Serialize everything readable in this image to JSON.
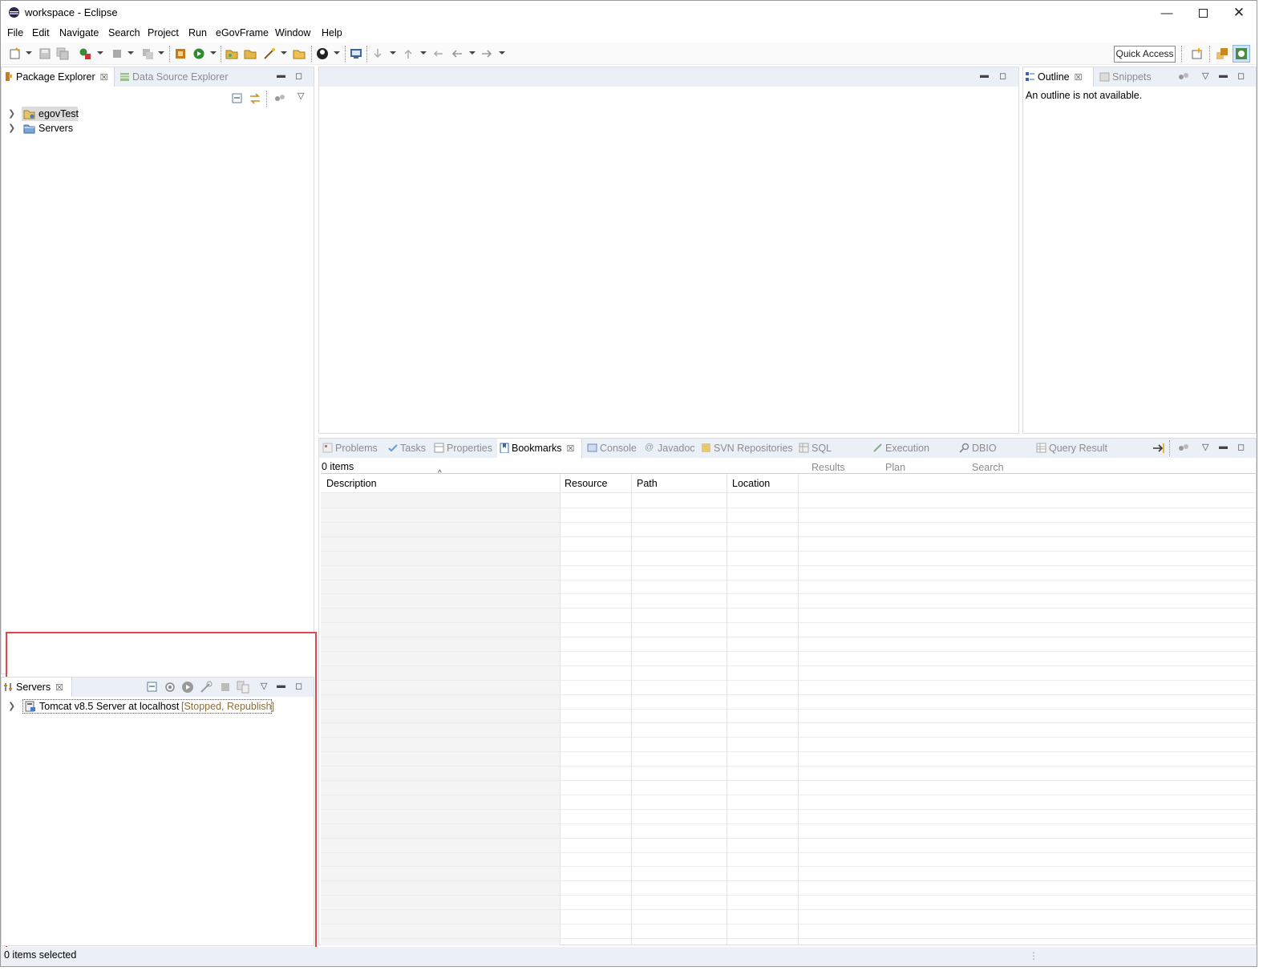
{
  "window": {
    "title": "workspace - Eclipse"
  },
  "menubar": {
    "items": [
      "File",
      "Edit",
      "Navigate",
      "Search",
      "Project",
      "Run",
      "eGovFrame",
      "Window",
      "Help"
    ]
  },
  "toolbar": {
    "quick_access": "Quick Access"
  },
  "left_panel": {
    "tabs": [
      "Package Explorer",
      "Data Source Explorer"
    ],
    "tree": [
      {
        "label": "egovTest",
        "icon": "project-icon"
      },
      {
        "label": "Servers",
        "icon": "folder-icon"
      }
    ]
  },
  "outline_panel": {
    "tabs": [
      "Outline",
      "Snippets"
    ],
    "message": "An outline is not available."
  },
  "bottom_panel": {
    "tabs": [
      "Problems",
      "Tasks",
      "Properties",
      "Bookmarks",
      "Console",
      "Javadoc",
      "SVN Repositories",
      "SQL Results",
      "Execution Plan",
      "DBIO Search",
      "Query Result"
    ],
    "active_tab": "Bookmarks",
    "item_count": "0 items",
    "columns": [
      "Description",
      "Resource",
      "Path",
      "Location"
    ]
  },
  "servers_panel": {
    "tab": "Servers",
    "server_name": "Tomcat v8.5 Server at localhost",
    "server_status": "[Stopped, Republish]"
  },
  "status": {
    "text": "0 items selected"
  },
  "colors": {
    "highlight": "#e0464a",
    "tab_strip": "#eaf0f6",
    "status_text": "#8a6d3b"
  }
}
